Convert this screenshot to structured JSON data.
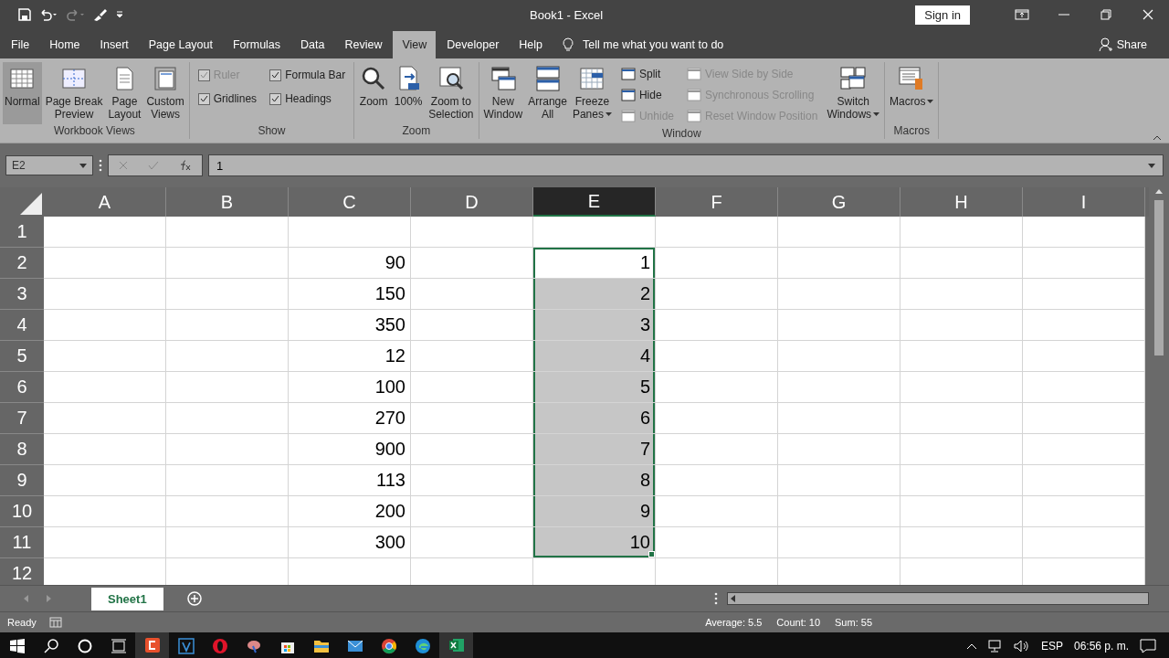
{
  "window": {
    "title": "Book1  -  Excel",
    "sign_in": "Sign in"
  },
  "menu": {
    "tabs": [
      {
        "label": "File",
        "selected": false
      },
      {
        "label": "Home",
        "selected": false
      },
      {
        "label": "Insert",
        "selected": false
      },
      {
        "label": "Page Layout",
        "selected": false
      },
      {
        "label": "Formulas",
        "selected": false
      },
      {
        "label": "Data",
        "selected": false
      },
      {
        "label": "Review",
        "selected": false
      },
      {
        "label": "View",
        "selected": true
      },
      {
        "label": "Developer",
        "selected": false
      },
      {
        "label": "Help",
        "selected": false
      }
    ],
    "tell_me": "Tell me what you want to do",
    "share": "Share"
  },
  "ribbon": {
    "groups": [
      {
        "label": "Workbook Views",
        "items": [
          {
            "kind": "large",
            "label": "Normal",
            "selected": true
          },
          {
            "kind": "large",
            "label": "Page Break\nPreview",
            "selected": false
          },
          {
            "kind": "large",
            "label": "Page\nLayout",
            "selected": false
          },
          {
            "kind": "large",
            "label": "Custom\nViews",
            "selected": false
          }
        ]
      },
      {
        "label": "Show",
        "items": [
          {
            "kind": "stack",
            "items": [
              {
                "kind": "check",
                "label": "Ruler",
                "checked": true,
                "disabled": true
              },
              {
                "kind": "check",
                "label": "Gridlines",
                "checked": true,
                "disabled": false
              }
            ]
          },
          {
            "kind": "stack",
            "items": [
              {
                "kind": "check",
                "label": "Formula Bar",
                "checked": true,
                "disabled": false
              },
              {
                "kind": "check",
                "label": "Headings",
                "checked": true,
                "disabled": false
              }
            ]
          }
        ]
      },
      {
        "label": "Zoom",
        "items": [
          {
            "kind": "large",
            "label": "Zoom"
          },
          {
            "kind": "large",
            "label": "100%"
          },
          {
            "kind": "large",
            "label": "Zoom to\nSelection"
          }
        ]
      },
      {
        "label": "Window",
        "items": [
          {
            "kind": "large",
            "label": "New\nWindow"
          },
          {
            "kind": "large",
            "label": "Arrange\nAll"
          },
          {
            "kind": "large",
            "label": "Freeze\nPanes",
            "dropdown": true
          },
          {
            "kind": "stack",
            "items": [
              {
                "kind": "small",
                "label": "Split",
                "disabled": false
              },
              {
                "kind": "small",
                "label": "Hide",
                "disabled": false
              },
              {
                "kind": "small",
                "label": "Unhide",
                "disabled": true
              }
            ]
          },
          {
            "kind": "stack",
            "items": [
              {
                "kind": "small",
                "label": "View Side by Side",
                "disabled": true
              },
              {
                "kind": "small",
                "label": "Synchronous Scrolling",
                "disabled": true
              },
              {
                "kind": "small",
                "label": "Reset Window Position",
                "disabled": true
              }
            ]
          },
          {
            "kind": "large",
            "label": "Switch\nWindows",
            "dropdown": true
          }
        ]
      },
      {
        "label": "Macros",
        "items": [
          {
            "kind": "large",
            "label": "Macros",
            "dropdown": true
          }
        ]
      }
    ]
  },
  "formula_bar": {
    "name_box": "E2",
    "value": "1"
  },
  "sheet": {
    "columns": [
      {
        "label": "A",
        "selected": false
      },
      {
        "label": "B",
        "selected": false
      },
      {
        "label": "C",
        "selected": false
      },
      {
        "label": "D",
        "selected": false
      },
      {
        "label": "E",
        "selected": true
      },
      {
        "label": "F",
        "selected": false
      },
      {
        "label": "G",
        "selected": false
      },
      {
        "label": "H",
        "selected": false
      },
      {
        "label": "I",
        "selected": false
      }
    ],
    "rows": [
      {
        "label": "1"
      },
      {
        "label": "2",
        "c": "90",
        "e": {
          "value": "1",
          "selected": true,
          "active": true
        }
      },
      {
        "label": "3",
        "c": "150",
        "e": {
          "value": "2",
          "selected": true,
          "active": false
        }
      },
      {
        "label": "4",
        "c": "350",
        "e": {
          "value": "3",
          "selected": true,
          "active": false
        }
      },
      {
        "label": "5",
        "c": "12",
        "e": {
          "value": "4",
          "selected": true,
          "active": false
        }
      },
      {
        "label": "6",
        "c": "100",
        "e": {
          "value": "5",
          "selected": true,
          "active": false
        }
      },
      {
        "label": "7",
        "c": "270",
        "e": {
          "value": "6",
          "selected": true,
          "active": false
        }
      },
      {
        "label": "8",
        "c": "900",
        "e": {
          "value": "7",
          "selected": true,
          "active": false
        }
      },
      {
        "label": "9",
        "c": "113",
        "e": {
          "value": "8",
          "selected": true,
          "active": false
        }
      },
      {
        "label": "10",
        "c": "200",
        "e": {
          "value": "9",
          "selected": true,
          "active": false
        }
      },
      {
        "label": "11",
        "c": "300",
        "e": {
          "value": "10",
          "selected": true,
          "active": false
        }
      },
      {
        "label": "12"
      }
    ]
  },
  "sheet_tabs": [
    {
      "label": "Sheet1",
      "selected": true
    }
  ],
  "status_bar": {
    "mode": "Ready",
    "average": "Average: 5.5",
    "count": "Count: 10",
    "sum": "Sum: 55"
  },
  "taskbar": {
    "language": "ESP",
    "time": "06:56 p. m."
  }
}
